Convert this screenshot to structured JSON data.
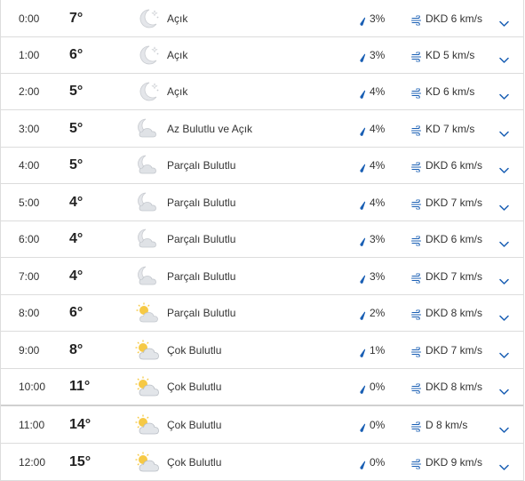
{
  "rows": [
    {
      "time": "0:00",
      "temp": "7°",
      "icon": "moon-stars-icon",
      "condition": "Açık",
      "precip": "3%",
      "wind": "DKD 6 km/s"
    },
    {
      "time": "1:00",
      "temp": "6°",
      "icon": "moon-stars-icon",
      "condition": "Açık",
      "precip": "3%",
      "wind": "KD 5 km/s"
    },
    {
      "time": "2:00",
      "temp": "5°",
      "icon": "moon-stars-icon",
      "condition": "Açık",
      "precip": "4%",
      "wind": "KD 6 km/s"
    },
    {
      "time": "3:00",
      "temp": "5°",
      "icon": "moon-cloud-icon",
      "condition": "Az Bulutlu ve Açık",
      "precip": "4%",
      "wind": "KD 7 km/s"
    },
    {
      "time": "4:00",
      "temp": "5°",
      "icon": "moon-cloud-icon",
      "condition": "Parçalı Bulutlu",
      "precip": "4%",
      "wind": "DKD 6 km/s"
    },
    {
      "time": "5:00",
      "temp": "4°",
      "icon": "moon-cloud-icon",
      "condition": "Parçalı Bulutlu",
      "precip": "4%",
      "wind": "DKD 7 km/s"
    },
    {
      "time": "6:00",
      "temp": "4°",
      "icon": "moon-cloud-icon",
      "condition": "Parçalı Bulutlu",
      "precip": "3%",
      "wind": "DKD 6 km/s"
    },
    {
      "time": "7:00",
      "temp": "4°",
      "icon": "moon-cloud-icon",
      "condition": "Parçalı Bulutlu",
      "precip": "3%",
      "wind": "DKD 7 km/s"
    },
    {
      "time": "8:00",
      "temp": "6°",
      "icon": "sun-cloud-icon",
      "condition": "Parçalı Bulutlu",
      "precip": "2%",
      "wind": "DKD 8 km/s"
    },
    {
      "time": "9:00",
      "temp": "8°",
      "icon": "cloud-sun-icon",
      "condition": "Çok Bulutlu",
      "precip": "1%",
      "wind": "DKD 7 km/s"
    },
    {
      "time": "10:00",
      "temp": "11°",
      "icon": "cloud-sun-icon",
      "condition": "Çok Bulutlu",
      "precip": "0%",
      "wind": "DKD 8 km/s"
    },
    {
      "time": "11:00",
      "temp": "14°",
      "icon": "cloud-sun-icon",
      "condition": "Çok Bulutlu",
      "precip": "0%",
      "wind": "D 8 km/s"
    },
    {
      "time": "12:00",
      "temp": "15°",
      "icon": "cloud-sun-icon",
      "condition": "Çok Bulutlu",
      "precip": "0%",
      "wind": "DKD 9 km/s"
    }
  ],
  "colors": {
    "accent": "#1a5fb4",
    "moon": "#e4e6ea",
    "cloud": "#dfe2e6",
    "sun": "#f6c945",
    "divider": "#dcdcdc"
  }
}
